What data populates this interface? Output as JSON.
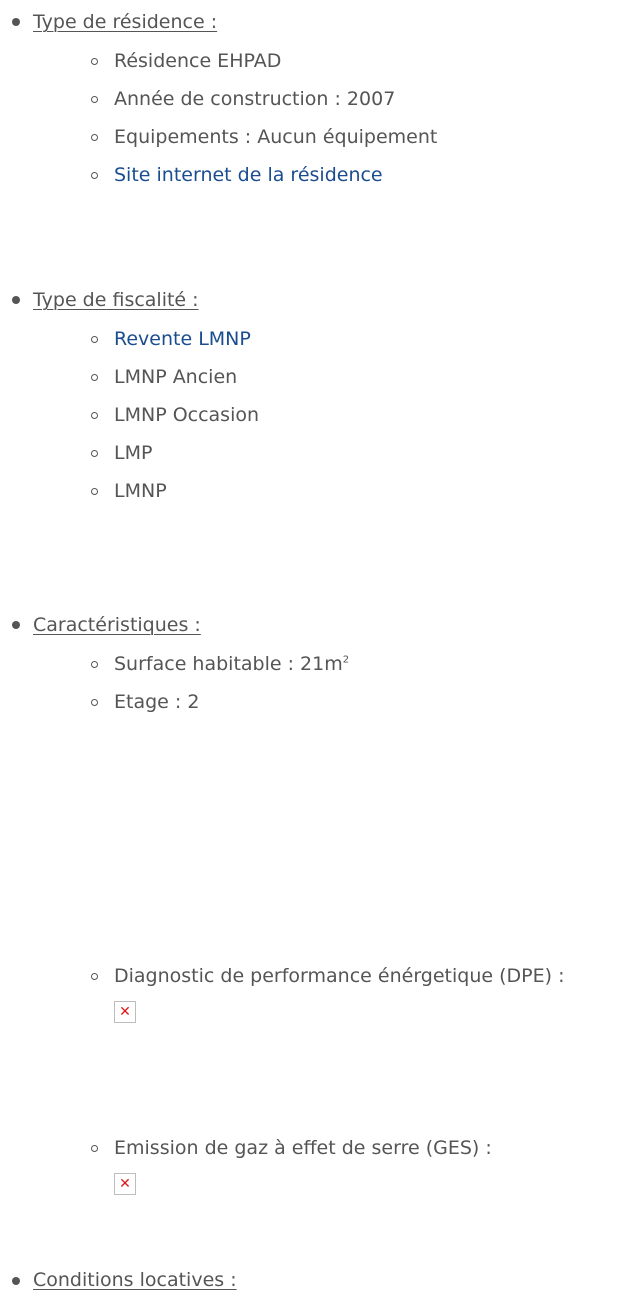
{
  "sections": [
    {
      "heading": "Type de résidence :",
      "items": [
        {
          "label": "Résidence EHPAD"
        },
        {
          "label": "Année de construction : 2007"
        },
        {
          "label": "Equipements : Aucun équipement"
        },
        {
          "label": "Site internet de la résidence",
          "link": true
        }
      ]
    },
    {
      "heading": "Type de fiscalité :",
      "items": [
        {
          "label": "Revente LMNP",
          "link": true
        },
        {
          "label": "LMNP Ancien"
        },
        {
          "label": "LMNP Occasion"
        },
        {
          "label": "LMP"
        },
        {
          "label": "LMNP"
        }
      ]
    },
    {
      "heading": "Caractéristiques :",
      "items": [
        {
          "label": "Surface habitable : 21m",
          "sup": "2"
        },
        {
          "label": "Etage : 2"
        },
        {
          "label": "Diagnostic de performance énérgetique (DPE) :",
          "image": "broken-image-icon"
        },
        {
          "label": "Emission de gaz à effet de serre (GES) :",
          "image": "broken-image-icon"
        }
      ]
    },
    {
      "heading": "Conditions locatives :",
      "items": []
    }
  ],
  "colors": {
    "text": "#555555",
    "link": "#1a4d8f",
    "broken_image_x": "#d81b1b"
  }
}
